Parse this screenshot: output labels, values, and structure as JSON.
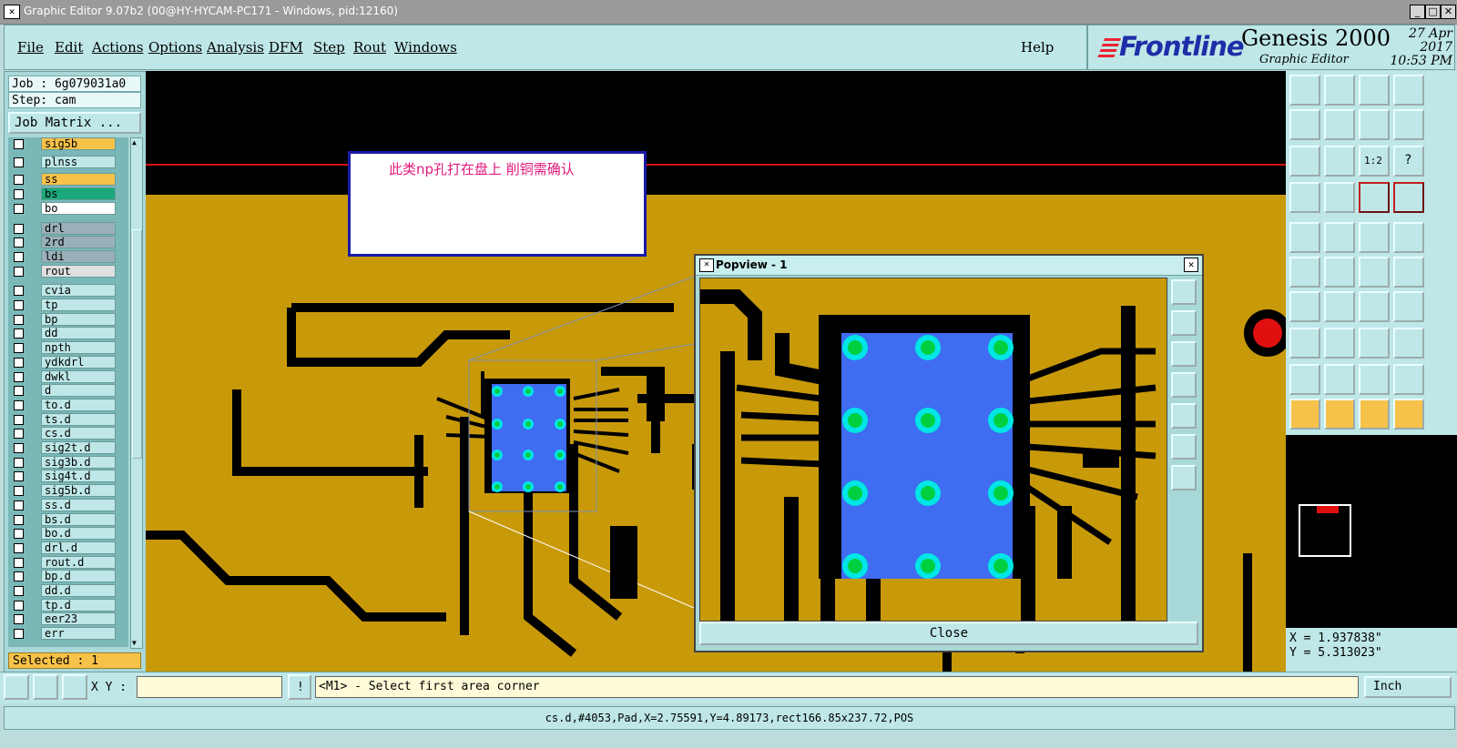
{
  "window": {
    "title": "Graphic Editor 9.07b2 (00@HY-HYCAM-PC171 - Windows, pid:12160)"
  },
  "menu": [
    "File",
    "Edit",
    "Actions",
    "Options",
    "Analysis",
    "DFM",
    "Step",
    "Rout",
    "Windows"
  ],
  "help": "Help",
  "brand": {
    "logo": "Frontline",
    "product": "Genesis 2000",
    "subtitle": "Graphic Editor",
    "date": "27 Apr 2017",
    "time": "10:53 PM"
  },
  "job": {
    "job_line": "Job : 6g079031a0",
    "step_line": "Step: cam",
    "matrix_button": "Job Matrix ..."
  },
  "layers": [
    {
      "name": "sig5b",
      "color": "#f7c24a"
    },
    {
      "name": "plnss",
      "color": "#bfe7e7"
    },
    {
      "name": "ss",
      "color": "#f7c24a"
    },
    {
      "name": "bs",
      "color": "#1aa87a"
    },
    {
      "name": "bo",
      "color": "#ffffff"
    },
    {
      "name": "drl",
      "color": "#9ab0b8"
    },
    {
      "name": "2rd",
      "color": "#9ab0b8"
    },
    {
      "name": "ldi",
      "color": "#9ab0b8"
    },
    {
      "name": "rout",
      "color": "#e0e0e0"
    },
    {
      "name": "cvia",
      "color": "#bfe7e7"
    },
    {
      "name": "tp",
      "color": "#bfe7e7"
    },
    {
      "name": "bp",
      "color": "#bfe7e7"
    },
    {
      "name": "dd",
      "color": "#bfe7e7"
    },
    {
      "name": "npth",
      "color": "#bfe7e7"
    },
    {
      "name": "ydkdrl",
      "color": "#bfe7e7"
    },
    {
      "name": "dwkl",
      "color": "#bfe7e7"
    },
    {
      "name": "d",
      "color": "#bfe7e7"
    },
    {
      "name": "to.d",
      "color": "#bfe7e7"
    },
    {
      "name": "ts.d",
      "color": "#bfe7e7"
    },
    {
      "name": "cs.d",
      "color": "#bfe7e7"
    },
    {
      "name": "sig2t.d",
      "color": "#bfe7e7"
    },
    {
      "name": "sig3b.d",
      "color": "#bfe7e7"
    },
    {
      "name": "sig4t.d",
      "color": "#bfe7e7"
    },
    {
      "name": "sig5b.d",
      "color": "#bfe7e7"
    },
    {
      "name": "ss.d",
      "color": "#bfe7e7"
    },
    {
      "name": "bs.d",
      "color": "#bfe7e7"
    },
    {
      "name": "bo.d",
      "color": "#bfe7e7"
    },
    {
      "name": "drl.d",
      "color": "#bfe7e7"
    },
    {
      "name": "rout.d",
      "color": "#bfe7e7"
    },
    {
      "name": "bp.d",
      "color": "#bfe7e7"
    },
    {
      "name": "dd.d",
      "color": "#bfe7e7"
    },
    {
      "name": "tp.d",
      "color": "#bfe7e7"
    },
    {
      "name": "eer23",
      "color": "#bfe7e7"
    },
    {
      "name": "err",
      "color": "#bfe7e7"
    }
  ],
  "selected": "Selected : 1",
  "note": "此类np孔打在盘上   削铜需确认",
  "popview": {
    "title": "Popview - 1",
    "close": "Close"
  },
  "coords": {
    "x": "X =  1.937838\"",
    "y": "Y =  5.313023\""
  },
  "cmd": {
    "xy_label": "X Y :",
    "xy_value": "",
    "prompt": "<M1> - Select first area corner",
    "unit": "Inch"
  },
  "status": "cs.d,#4053,Pad,X=2.75591,Y=4.89173,rect166.85x237.72,POS",
  "colors": {
    "copper": "#c89a0a",
    "pad": "#4a6af0",
    "via_ring": "#00e5e5",
    "via_center": "#00d040"
  }
}
